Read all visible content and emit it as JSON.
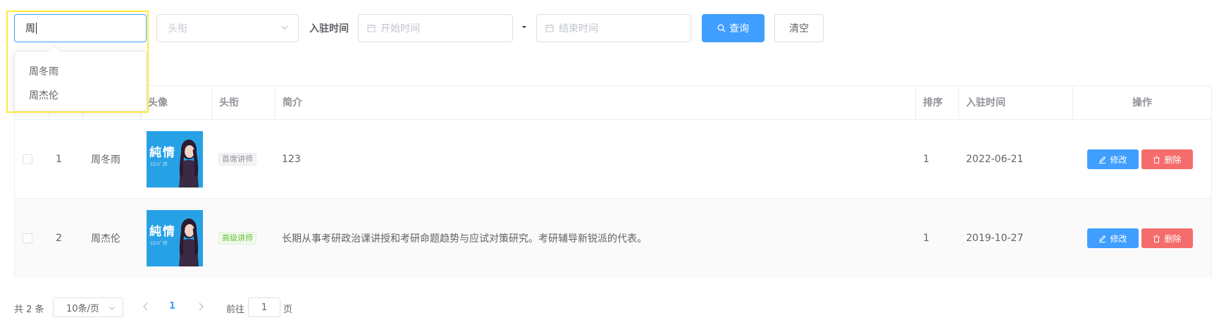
{
  "search": {
    "name_value": "周",
    "title_placeholder": "头衔",
    "time_label": "入驻时间",
    "start_placeholder": "开始时间",
    "date_separator": "-",
    "end_placeholder": "结束时间",
    "search_label": "查询",
    "clear_label": "清空",
    "suggestions": [
      "周冬雨",
      "周杰伦"
    ]
  },
  "table": {
    "headers": [
      "头像",
      "头衔",
      "简介",
      "排序",
      "入驻时间",
      "操作"
    ],
    "rows": [
      {
        "index": "1",
        "name": "周冬雨",
        "avatar_text": "純情",
        "avatar_sub": "ｼﾕﾝｼﾞﾖｳ",
        "title": "首席讲师",
        "intro": "123",
        "sort": "1",
        "join_date": "2022-06-21",
        "edit_label": "修改",
        "delete_label": "删除"
      },
      {
        "index": "2",
        "name": "周杰伦",
        "avatar_text": "純情",
        "avatar_sub": "ｼﾕﾝｼﾞﾖｳ",
        "title": "高级讲师",
        "intro": "长期从事考研政治课讲授和考研命题趋势与应试对策研究。考研辅导新锐派的代表。",
        "sort": "1",
        "join_date": "2019-10-27",
        "edit_label": "修改",
        "delete_label": "删除"
      }
    ]
  },
  "pagination": {
    "total": "共 2 条",
    "page_size": "10条/页",
    "current_page": "1",
    "goto_label": "前往",
    "goto_value": "1",
    "page_unit": "页"
  },
  "colors": {
    "primary": "#409eff",
    "danger": "#f56c6c",
    "success": "#67c23a",
    "highlight": "#ffeb3b"
  }
}
